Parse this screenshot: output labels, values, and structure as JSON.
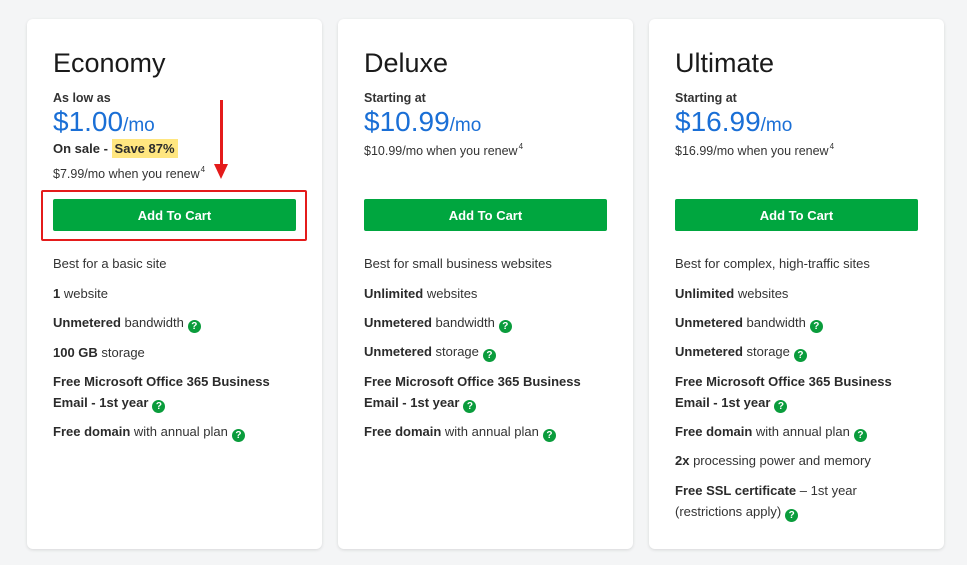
{
  "plans": [
    {
      "name": "Economy",
      "price_lead": "As low as",
      "price": "$1.00",
      "per": "/mo",
      "sale_label": "On sale -",
      "save_badge": "Save 87%",
      "renew_text": "$7.99/mo when you renew",
      "renew_footnote": "4",
      "cta": "Add To Cart",
      "features": {
        "f0": "Best for a basic site",
        "f1_bold": "1",
        "f1_text": " website",
        "f2_bold": "Unmetered",
        "f2_text": " bandwidth",
        "f3_bold": "100 GB",
        "f3_text": " storage",
        "f4_bold_a": "Free Microsoft Office 365 Business",
        "f4_bold_b": "Email - 1st year",
        "f5_bold": "Free domain",
        "f5_text": " with annual plan"
      }
    },
    {
      "name": "Deluxe",
      "price_lead": "Starting at",
      "price": "$10.99",
      "per": "/mo",
      "renew_text": "$10.99/mo when you renew",
      "renew_footnote": "4",
      "cta": "Add To Cart",
      "features": {
        "f0": "Best for small business websites",
        "f1_bold": "Unlimited",
        "f1_text": " websites",
        "f2_bold": "Unmetered",
        "f2_text": " bandwidth",
        "f3_bold": "Unmetered",
        "f3_text": " storage",
        "f4_bold_a": "Free Microsoft Office 365 Business",
        "f4_bold_b": "Email - 1st year",
        "f5_bold": "Free domain",
        "f5_text": " with annual plan"
      }
    },
    {
      "name": "Ultimate",
      "price_lead": "Starting at",
      "price": "$16.99",
      "per": "/mo",
      "renew_text": "$16.99/mo when you renew",
      "renew_footnote": "4",
      "cta": "Add To Cart",
      "features": {
        "f0": "Best for complex, high-traffic sites",
        "f1_bold": "Unlimited",
        "f1_text": " websites",
        "f2_bold": "Unmetered",
        "f2_text": " bandwidth",
        "f3_bold": "Unmetered",
        "f3_text": " storage",
        "f4_bold_a": "Free Microsoft Office 365 Business",
        "f4_bold_b": "Email - 1st year",
        "f5_bold": "Free domain",
        "f5_text": " with annual plan",
        "f6_bold": "2x",
        "f6_text": " processing power and memory",
        "f7_bold": "Free SSL certificate",
        "f7_text": " – 1st year",
        "f7_text_b": "(restrictions apply)"
      }
    }
  ],
  "help_glyph": "?",
  "colors": {
    "accent_blue": "#1a6fd6",
    "cta_green": "#00a63f",
    "annotation_red": "#e41b1b",
    "save_yellow": "#ffe680"
  }
}
